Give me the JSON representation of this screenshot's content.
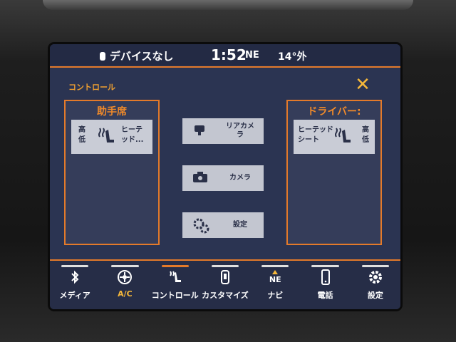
{
  "status": {
    "device": "デバイスなし",
    "time": "1:52",
    "direction": "NE",
    "temp": "14°外"
  },
  "page": {
    "title": "コントロール"
  },
  "passenger": {
    "title": "助手席",
    "level_high": "高",
    "level_low": "低",
    "label_line1": "ヒーテ",
    "label_line2": "ッド..."
  },
  "driver": {
    "title": "ドライバー:",
    "label_line1": "ヒーテッド",
    "label_line2": "シート",
    "level_high": "高",
    "level_low": "低"
  },
  "controls": [
    {
      "label_line1": "リアカメ",
      "label_line2": "ラ"
    },
    {
      "label_line1": "カメラ",
      "label_line2": ""
    },
    {
      "label_line1": "設定",
      "label_line2": ""
    }
  ],
  "tabs": [
    {
      "label": "メディア",
      "icon": "bluetooth-icon"
    },
    {
      "label": "A/C",
      "icon": "climate-icon"
    },
    {
      "label": "コントロール",
      "icon": "seat-control-icon"
    },
    {
      "label": "カスタマイズ",
      "icon": "customize-icon"
    },
    {
      "label": "ナビ",
      "icon": "navigation-icon",
      "badge": "NE"
    },
    {
      "label": "電話",
      "icon": "phone-icon"
    },
    {
      "label": "設定",
      "icon": "gear-icon"
    }
  ],
  "colors": {
    "accent": "#e47a2a",
    "screen_bg": "#2b3452",
    "button": "#c9ccd6",
    "close": "#f5b73a"
  }
}
